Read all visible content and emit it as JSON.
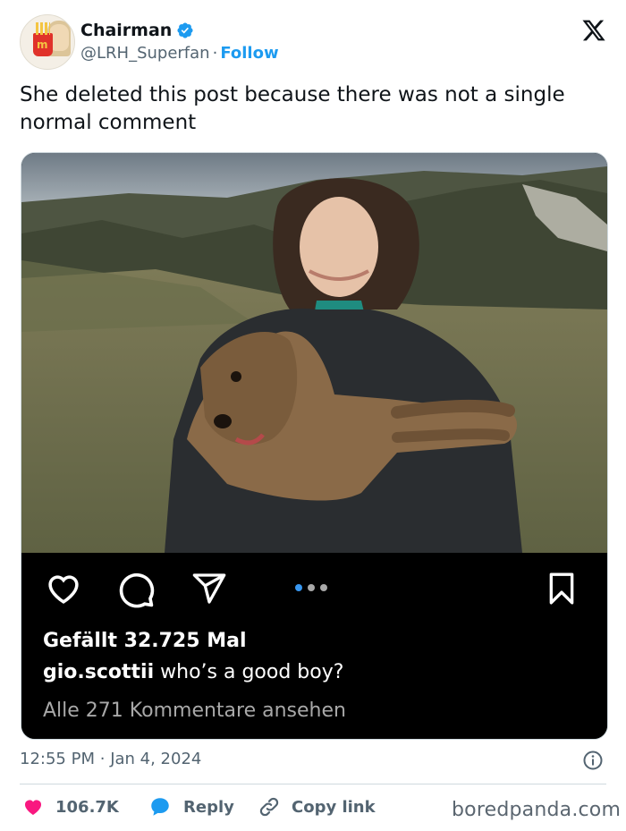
{
  "author": {
    "display_name": "Chairman",
    "handle": "@LRH_Superfan",
    "separator": "·",
    "follow_label": "Follow",
    "verified": true
  },
  "tweet": {
    "text": "She deleted this post because there was not a single normal comment"
  },
  "embedded_post": {
    "likes_text": "Gefällt 32.725 Mal",
    "caption_user": "gio.scottii",
    "caption_text": " who’s a good boy?",
    "view_comments": "Alle 271 Kommentare ansehen",
    "carousel_active": 1,
    "carousel_count": 3
  },
  "meta": {
    "time": "12:55 PM",
    "separator": "·",
    "date": "Jan 4, 2024"
  },
  "actions": {
    "like_count": "106.7K",
    "reply_label": "Reply",
    "copy_label": "Copy link"
  },
  "watermark": "boredpanda.com",
  "colors": {
    "accent": "#1d9bf0",
    "like": "#f91880",
    "text": "#0f1419",
    "muted": "#536471",
    "ig_dot_active": "#3897f0"
  },
  "icons": [
    "verified-badge-icon",
    "x-logo-icon",
    "heart-icon",
    "comment-icon",
    "share-icon",
    "bookmark-icon",
    "info-icon",
    "reply-bubble-icon",
    "link-icon"
  ]
}
